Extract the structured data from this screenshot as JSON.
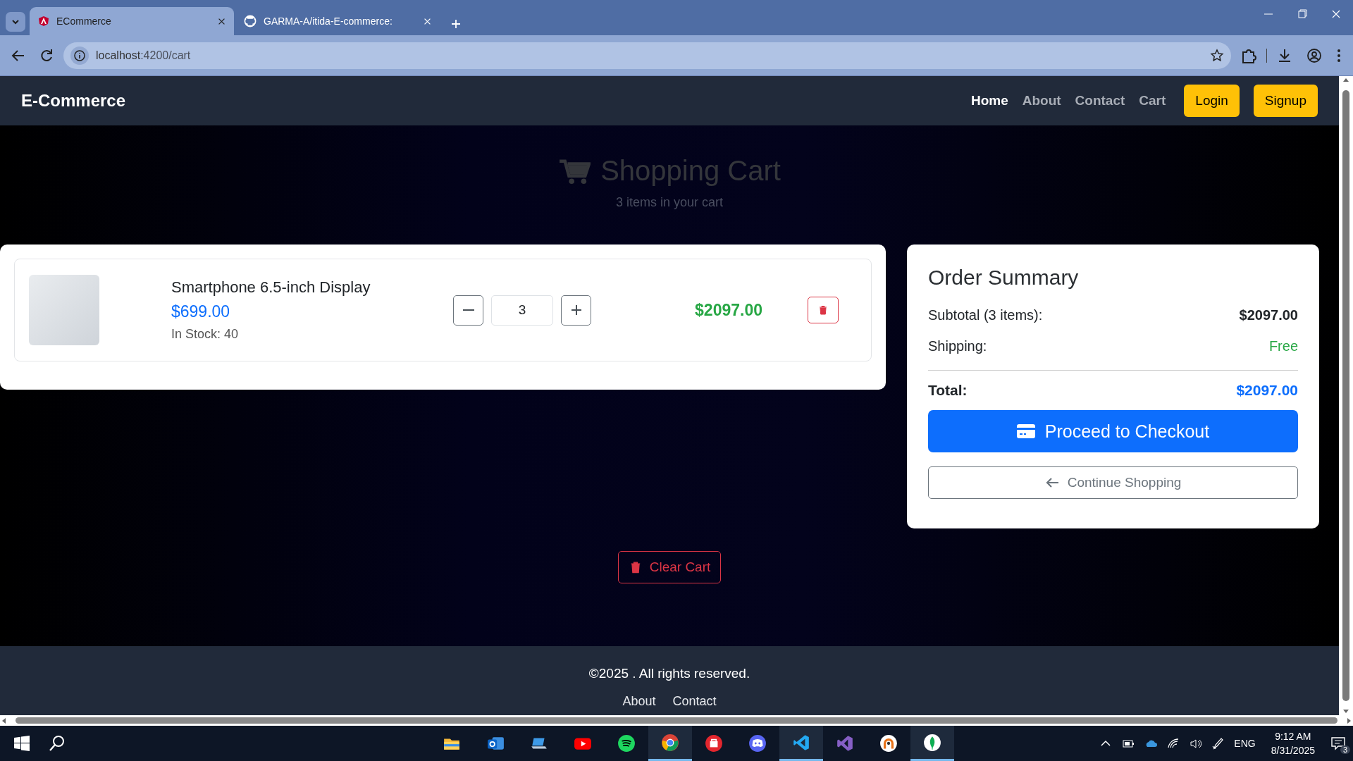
{
  "browser": {
    "tabs": [
      {
        "title": "ECommerce",
        "selected": true
      },
      {
        "title": "GARMA-A/itida-E-commerce:",
        "selected": false
      }
    ],
    "url_host": "localhost",
    "url_path": ":4200/cart"
  },
  "nav": {
    "brand": "E-Commerce",
    "links": [
      {
        "label": "Home",
        "selected": true
      },
      {
        "label": "About",
        "selected": false
      },
      {
        "label": "Contact",
        "selected": false
      },
      {
        "label": "Cart",
        "selected": false
      }
    ],
    "buttons": [
      "Login",
      "Signup"
    ]
  },
  "cart_header": {
    "title": "Shopping Cart",
    "subtitle": "3 items in your cart"
  },
  "items": [
    {
      "name": "Smartphone 6.5-inch Display",
      "price": "$699.00",
      "stock": "In Stock: 40",
      "quantity": "3",
      "line_total": "$2097.00"
    }
  ],
  "summary": {
    "title": "Order Summary",
    "rows": [
      {
        "kind": "subtotal",
        "label": "Subtotal (3 items):",
        "value": "$2097.00"
      },
      {
        "kind": "shipping",
        "label": "Shipping:",
        "value": "Free"
      }
    ],
    "total_label": "Total:",
    "total_value": "$2097.00",
    "checkout_button": "Proceed to Checkout",
    "continue_button": "Continue Shopping"
  },
  "clear_button": "Clear Cart",
  "footer": {
    "copyright": "©2025 . All rights reserved.",
    "links": [
      "About",
      "Contact"
    ]
  },
  "taskbar": {
    "apps": [
      {
        "kind": "folder",
        "running": false
      },
      {
        "kind": "mail",
        "running": false
      },
      {
        "kind": "laptop",
        "running": false
      },
      {
        "kind": "video",
        "running": false
      },
      {
        "kind": "music",
        "running": false
      },
      {
        "kind": "browser",
        "running": true
      },
      {
        "kind": "store",
        "running": false
      },
      {
        "kind": "chat",
        "running": false
      },
      {
        "kind": "code",
        "running": true
      },
      {
        "kind": "ide",
        "running": false
      },
      {
        "kind": "vpn",
        "running": false
      },
      {
        "kind": "leaf",
        "running": true
      }
    ],
    "language": "ENG",
    "time": "9:12 AM",
    "date": "8/31/2025",
    "notifications": "3"
  }
}
